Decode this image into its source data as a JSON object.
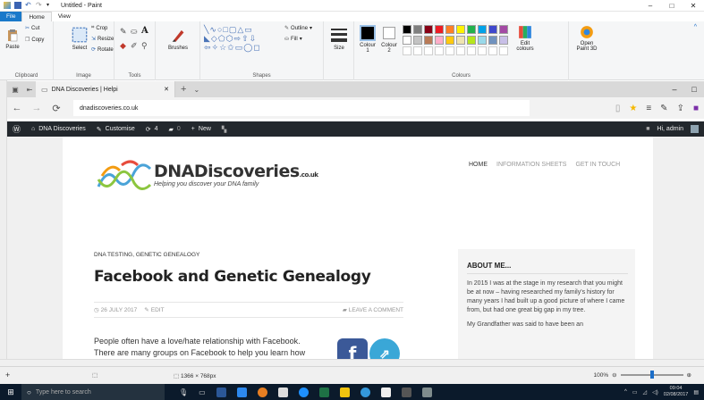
{
  "paint": {
    "window_title": "Untitled - Paint",
    "tabs": [
      "File",
      "Home",
      "View"
    ],
    "window_controls": [
      "–",
      "□",
      "✕"
    ],
    "clipboard": {
      "paste": "Paste",
      "cut": "Cut",
      "copy": "Copy",
      "label": "Clipboard"
    },
    "image": {
      "select": "Select",
      "crop": "Crop",
      "resize": "Resize",
      "rotate": "Rotate",
      "label": "Image"
    },
    "tools": {
      "label": "Tools",
      "brushes": "Brushes"
    },
    "shapes": {
      "label": "Shapes",
      "outline": "Outline",
      "fill": "Fill"
    },
    "size": {
      "label": "Size"
    },
    "colours": {
      "colour1": "Colour 1",
      "colour1_line1": "Colour",
      "colour1_line2": "1",
      "colour2": "Colour 2",
      "colour2_line1": "Colour",
      "colour2_line2": "2",
      "label": "Colours",
      "edit": "Edit colours",
      "edit_line1": "Edit",
      "edit_line2": "colours",
      "palette_row1": [
        "#000000",
        "#7f7f7f",
        "#880015",
        "#ed1c24",
        "#ff7f27",
        "#fff200",
        "#22b14c",
        "#00a2e8",
        "#3f48cc",
        "#a349a4"
      ],
      "palette_row2": [
        "#ffffff",
        "#c3c3c3",
        "#b97a57",
        "#ffaec9",
        "#ffc90e",
        "#efe4b0",
        "#b5e61d",
        "#99d9ea",
        "#7092be",
        "#c8bfe7"
      ]
    },
    "paint3d": "Open Paint 3D",
    "paint3d_line1": "Open",
    "paint3d_line2": "Paint 3D",
    "status": {
      "dimensions": "1366 × 768px",
      "zoom": "100%",
      "zoom_level": 0.5
    }
  },
  "browser": {
    "tab_title": "DNA Discoveries | Helpi",
    "tab_close": "✕",
    "url": "dnadiscoveries.co.uk",
    "controls": [
      "–",
      "□"
    ]
  },
  "wp_admin": {
    "site": "DNA Discoveries",
    "customise": "Customise",
    "updates": "4",
    "comments": "0",
    "new": "New",
    "greeting": "Hi, admin"
  },
  "site": {
    "logo_title": "DNADiscoveries",
    "logo_suffix": ".co.uk",
    "tagline": "Helping you discover your DNA family",
    "nav": [
      "HOME",
      "INFORMATION SHEETS",
      "GET IN TOUCH"
    ]
  },
  "post": {
    "categories": "DNA TESTING, GENETIC GENEALOGY",
    "title": "Facebook and Genetic Genealogy",
    "date": "26 JULY 2017",
    "edit": "EDIT",
    "leave_comment": "LEAVE A COMMENT",
    "body": "People often have a love/hate relationship with Facebook. There are many groups on Facebook to help you learn how"
  },
  "sidebar": {
    "heading": "ABOUT ME...",
    "para1": "In 2015 I was at the stage in my research that you might be at now – having researched my family's history for many years I had built up a good picture of where I came from, but had one great big gap in my tree.",
    "para2": "My Grandfather was said to have been an"
  },
  "taskbar": {
    "search_placeholder": "Type here to search",
    "time": "09:04",
    "date": "02/08/2017"
  }
}
